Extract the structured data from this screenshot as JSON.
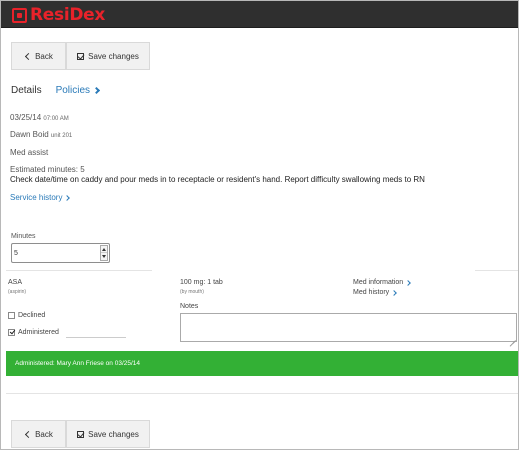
{
  "app": {
    "brand": "ResiDex"
  },
  "toolbar": {
    "back_label": "Back",
    "save_label": "Save changes"
  },
  "tabs": {
    "details": "Details",
    "policies": "Policies"
  },
  "service": {
    "date": "03/25/14",
    "time": "07:00 AM",
    "resident_name": "Dawn Boid",
    "unit": "unit 201",
    "service_name": "Med assist",
    "estimated_minutes": "Estimated minutes: 5",
    "instructions": "Check date/time on caddy and pour meds in to receptacle or resident's hand. Report difficulty swallowing meds to RN",
    "history_link": "Service history"
  },
  "minutes": {
    "label": "Minutes",
    "value": "5"
  },
  "medication": {
    "name": "ASA",
    "generic": "(aspirin)",
    "dose": "100 mg: 1 tab",
    "route": "(by mouth)",
    "info_link": "Med information",
    "history_link": "Med history"
  },
  "status": {
    "declined_label": "Declined",
    "declined_checked": false,
    "administered_label": "Administered",
    "administered_checked": true
  },
  "notes": {
    "label": "Notes",
    "value": ""
  },
  "banner": {
    "text": "Administered: Mary Ann Friese on 03/25/14",
    "color": "#33b035"
  },
  "colors": {
    "accent": "#e8222a",
    "link": "#2a7ab8",
    "topbar": "#2f2f2f"
  }
}
